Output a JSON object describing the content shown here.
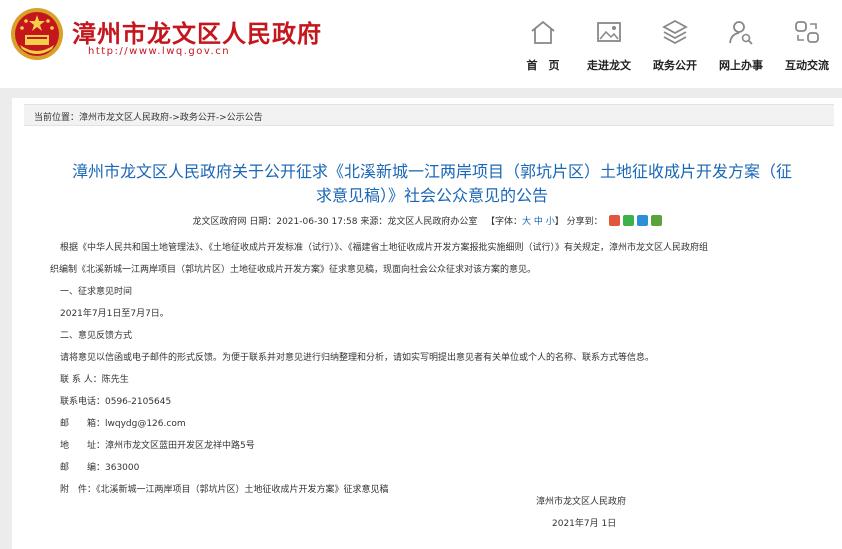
{
  "header": {
    "site_title": "漳州市龙文区人民政府",
    "site_url": "http://www.lwq.gov.cn",
    "nav": [
      {
        "label": "首　页",
        "icon": "home-icon"
      },
      {
        "label": "走进龙文",
        "icon": "image-icon"
      },
      {
        "label": "政务公开",
        "icon": "layers-icon"
      },
      {
        "label": "网上办事",
        "icon": "user-search-icon"
      },
      {
        "label": "互动交流",
        "icon": "interaction-icon"
      }
    ],
    "brand_color": "#c4161c"
  },
  "breadcrumb": {
    "prefix": "当前位置：",
    "items": [
      "漳州市龙文区人民政府",
      "政务公开",
      "公示公告"
    ],
    "separator": "->"
  },
  "article": {
    "title_line1": "漳州市龙文区人民政府关于公开征求《北溪新城一江两岸项目（郭坑片区）土地征收成片开发方案（征",
    "title_line2": "求意见稿）》社会公众意见的公告",
    "title_color": "#1a67b5",
    "meta": {
      "source": "龙文区政府网",
      "date_label": "日期：",
      "date": "2021-06-30 17:58",
      "origin_label": "来源：",
      "origin": "龙文区人民政府办公室",
      "font_label": "【字体：",
      "sizes": [
        "大",
        "中",
        "小"
      ],
      "font_close": "】",
      "share_label": "分享到："
    },
    "paragraphs": [
      "根据《中华人民共和国土地管理法》、《土地征收成片开发标准（试行）》、《福建省土地征收成片开发方案报批实施细则（试行）》有关规定，漳州市龙文区人民政府组",
      "织编制《北溪新城一江两岸项目（郭坑片区）土地征收成片开发方案》征求意见稿，现面向社会公众征求对该方案的意见。",
      "一、征求意见时间",
      "2021年7月1日至7月7日。",
      "二、意见反馈方式",
      "请将意见以信函或电子邮件的形式反馈。为便于联系并对意见进行归纳整理和分析，请如实写明提出意见者有关单位或个人的名称、联系方式等信息。",
      "联 系 人：陈先生",
      "联系电话：0596-2105645",
      "邮　　箱：lwqydg@126.com",
      "地　　址：漳州市龙文区蓝田开发区龙祥中路5号",
      "邮　　编：363000",
      "附　件：《北溪新城一江两岸项目（郭坑片区）土地征收成片开发方案》征求意见稿"
    ],
    "signature": {
      "org": "漳州市龙文区人民政府",
      "date": "2021年7月 1日"
    }
  }
}
